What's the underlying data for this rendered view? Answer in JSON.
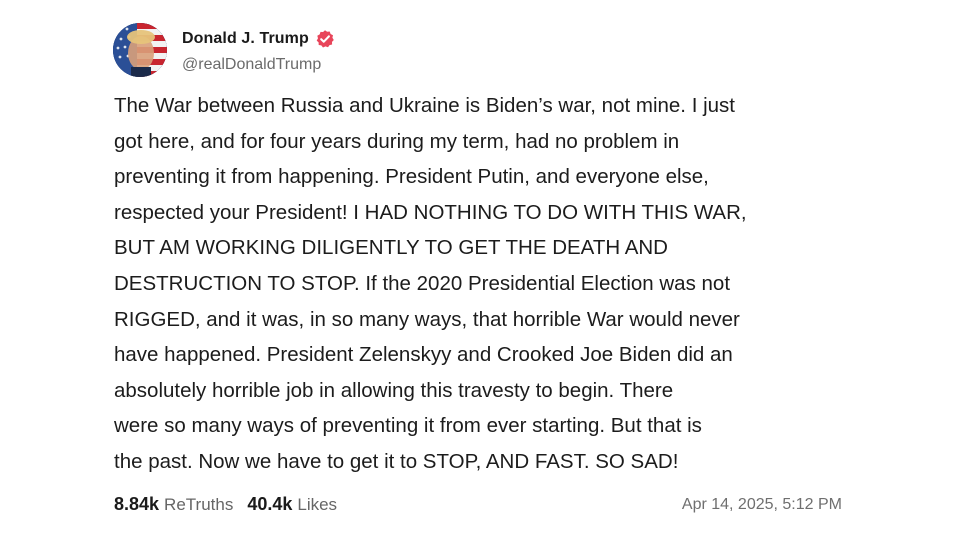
{
  "author": {
    "display_name": "Donald J. Trump",
    "handle": "@realDonaldTrump",
    "verified": true,
    "verified_badge_color": "#e8455a"
  },
  "post": {
    "lines": [
      "The War between Russia and Ukraine is Biden’s war, not mine. I just",
      "got here, and for four years during my term, had no problem in",
      "preventing it from happening. President Putin, and everyone else,",
      "respected your President! I HAD NOTHING TO DO WITH THIS WAR,",
      "BUT AM WORKING DILIGENTLY TO GET THE DEATH AND",
      "DESTRUCTION TO STOP. If the 2020 Presidential Election was not",
      "RIGGED, and it was, in so many ways, that horrible War would never",
      "have happened. President Zelenskyy and Crooked Joe Biden did an",
      "absolutely horrible job in allowing this travesty to begin. There",
      "were so many ways of preventing it from ever starting. But that is",
      "the past. Now we have to get it to STOP, AND FAST. SO SAD!"
    ]
  },
  "stats": {
    "retruths_count": "8.84k",
    "retruths_label": "ReTruths",
    "likes_count": "40.4k",
    "likes_label": "Likes"
  },
  "timestamp": "Apr 14, 2025, 5:12 PM"
}
